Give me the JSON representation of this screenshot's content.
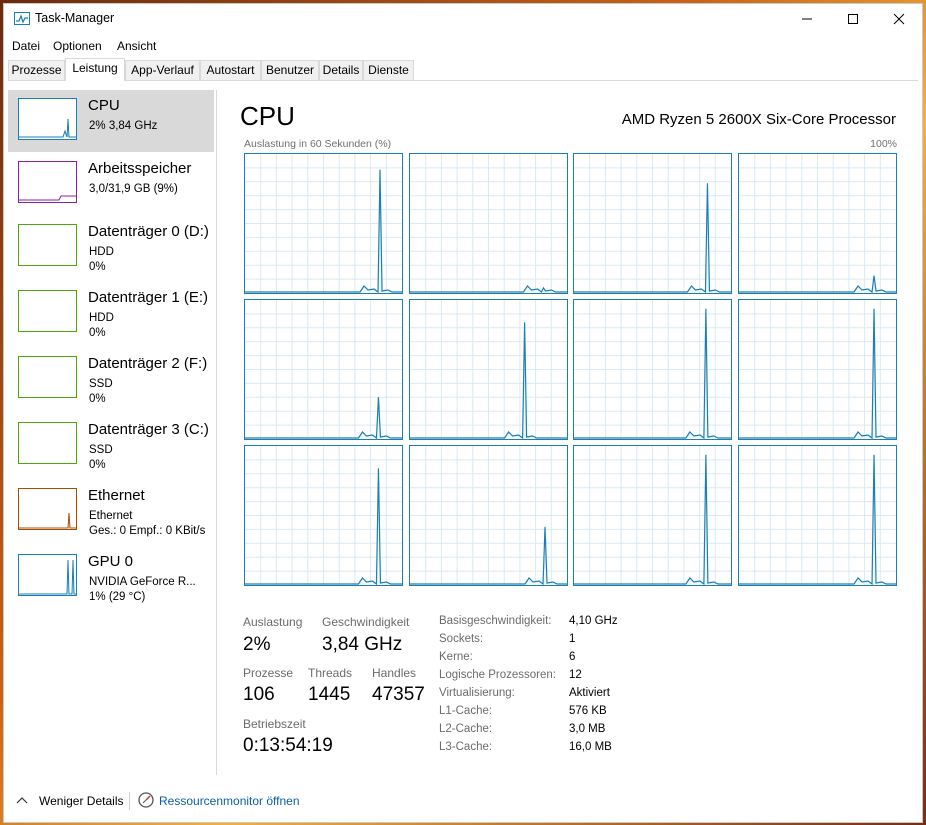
{
  "window": {
    "title": "Task-Manager"
  },
  "menu": [
    "Datei",
    "Optionen",
    "Ansicht"
  ],
  "tabs": [
    "Prozesse",
    "Leistung",
    "App-Verlauf",
    "Autostart",
    "Benutzer",
    "Details",
    "Dienste"
  ],
  "active_tab": "Leistung",
  "sidebar": [
    {
      "title": "CPU",
      "line1": "2% 3,84 GHz",
      "line2": "",
      "line3": "",
      "color": "#1a7fb5"
    },
    {
      "title": "Arbeitsspeicher",
      "line1": "3,0/31,9 GB (9%)",
      "line2": "",
      "line3": "",
      "color": "#8c1fa6"
    },
    {
      "title": "Datenträger 0 (D:)",
      "line1": "HDD",
      "line2": "0%",
      "line3": "",
      "color": "#4da60c"
    },
    {
      "title": "Datenträger 1 (E:)",
      "line1": "HDD",
      "line2": "0%",
      "line3": "",
      "color": "#4da60c"
    },
    {
      "title": "Datenträger 2 (F:)",
      "line1": "SSD",
      "line2": "0%",
      "line3": "",
      "color": "#4da60c"
    },
    {
      "title": "Datenträger 3 (C:)",
      "line1": "SSD",
      "line2": "0%",
      "line3": "",
      "color": "#4da60c"
    },
    {
      "title": "Ethernet",
      "line1": "Ethernet",
      "line2": "Ges.: 0 Empf.: 0 KBit/s",
      "line3": "",
      "color": "#a74f01"
    },
    {
      "title": "GPU 0",
      "line1": "NVIDIA GeForce R...",
      "line2": "1% (29 °C)",
      "line3": "",
      "color": "#1a7fb5"
    }
  ],
  "main": {
    "title": "CPU",
    "processor": "AMD Ryzen 5 2600X Six-Core Processor",
    "graph_label": "Auslastung in 60 Sekunden (%)",
    "graph_max": "100%"
  },
  "stats": {
    "auslastung_label": "Auslastung",
    "auslastung_value": "2%",
    "geschw_label": "Geschwindigkeit",
    "geschw_value": "3,84 GHz",
    "prozesse_label": "Prozesse",
    "prozesse_value": "106",
    "threads_label": "Threads",
    "threads_value": "1445",
    "handles_label": "Handles",
    "handles_value": "47357",
    "betrieb_label": "Betriebszeit",
    "betrieb_value": "0:13:54:19"
  },
  "info": [
    {
      "label": "Basisgeschwindigkeit:",
      "value": "4,10 GHz"
    },
    {
      "label": "Sockets:",
      "value": "1"
    },
    {
      "label": "Kerne:",
      "value": "6"
    },
    {
      "label": "Logische Prozessoren:",
      "value": "12"
    },
    {
      "label": "Virtualisierung:",
      "value": "Aktiviert"
    },
    {
      "label": "L1-Cache:",
      "value": "576 KB"
    },
    {
      "label": "L2-Cache:",
      "value": "3,0 MB"
    },
    {
      "label": "L3-Cache:",
      "value": "16,0 MB"
    }
  ],
  "footer": {
    "less_details": "Weniger Details",
    "resmon": "Ressourcenmonitor öffnen"
  },
  "colors": {
    "cpu_accent": "#1a7fb5",
    "graph_fill": "#f1f6fa",
    "grid": "#d9eaf4"
  },
  "core_count": 12,
  "core_load_peaks_percent": [
    90,
    3,
    80,
    12,
    30,
    85,
    95,
    95,
    85,
    42,
    95,
    95
  ]
}
